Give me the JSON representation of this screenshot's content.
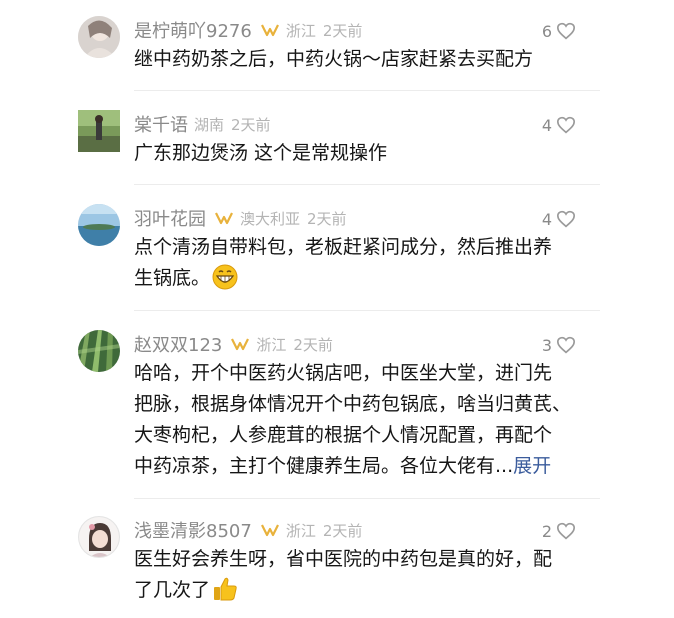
{
  "comments": [
    {
      "user": "是柠萌吖9276",
      "location": "浙江",
      "time": "2天前",
      "likes": "6",
      "has_badge": true,
      "text": "继中药奶茶之后，中药火锅～店家赶紧去买配方"
    },
    {
      "user": "棠千语",
      "location": "湖南",
      "time": "2天前",
      "likes": "4",
      "has_badge": false,
      "text": "广东那边煲汤 这个是常规操作"
    },
    {
      "user": "羽叶花园",
      "location": "澳大利亚",
      "time": "2天前",
      "likes": "4",
      "has_badge": true,
      "text_line1": "点个清汤自带料包，老板赶紧问成分，然后推出养",
      "text_line2": "生锅底。",
      "emoji": "grinning-face-emoji"
    },
    {
      "user": "赵双双123",
      "location": "浙江",
      "time": "2天前",
      "likes": "3",
      "has_badge": true,
      "text_line1": "哈哈，开个中医药火锅店吧，中医坐大堂，进门先",
      "text_line2": "把脉，根据身体情况开个中药包锅底，啥当归黄芪、",
      "text_line3": "大枣枸杞，人参鹿茸的根据个人情况配置，再配个",
      "text_line4": "中药凉茶，主打个健康养生局。各位大佬有...",
      "expand_label": "展开"
    },
    {
      "user": "浅墨清影8507",
      "location": "浙江",
      "time": "2天前",
      "likes": "2",
      "has_badge": true,
      "text_line1": "医生好会养生呀，省中医院的中药包是真的好，配",
      "text_line2": "了几次了",
      "emoji": "thumbs-up-emoji"
    }
  ],
  "colors": {
    "username": "#8a8a8a",
    "meta": "#b4b4b4",
    "body_text": "#161616",
    "expand_link": "#3b5c9c",
    "badge_gold": "#e8b23c",
    "divider": "#ececec"
  },
  "icons": {
    "like": "heart-outline-icon",
    "badge": "gold-loop-badge-icon"
  }
}
